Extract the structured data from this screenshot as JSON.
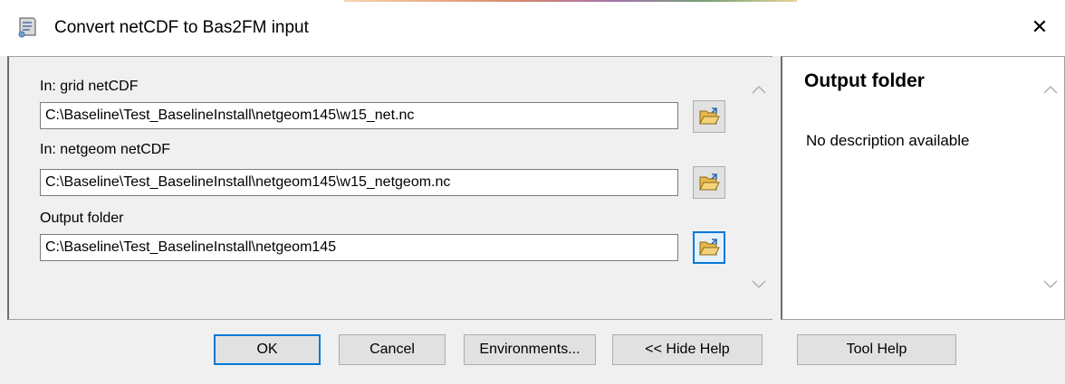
{
  "window": {
    "title": "Convert netCDF to Bas2FM input",
    "close_glyph": "✕"
  },
  "form": {
    "fields": [
      {
        "label": "In: grid netCDF",
        "value": "C:\\Baseline\\Test_BaselineInstall\\netgeom145\\w15_net.nc"
      },
      {
        "label": "In: netgeom netCDF",
        "value": "C:\\Baseline\\Test_BaselineInstall\\netgeom145\\w15_netgeom.nc"
      },
      {
        "label": "Output folder",
        "value": "C:\\Baseline\\Test_BaselineInstall\\netgeom145"
      }
    ]
  },
  "help": {
    "title": "Output folder",
    "description": "No description available"
  },
  "buttons": {
    "ok": "OK",
    "cancel": "Cancel",
    "environments": "Environments...",
    "hide_help": "<< Hide Help",
    "tool_help": "Tool Help"
  },
  "colors": {
    "accent": "#0078d7",
    "folder": "#e8b84a"
  },
  "icons": {
    "title": "tool-scroll-icon",
    "browse": "open-folder-icon",
    "close": "close-icon"
  }
}
